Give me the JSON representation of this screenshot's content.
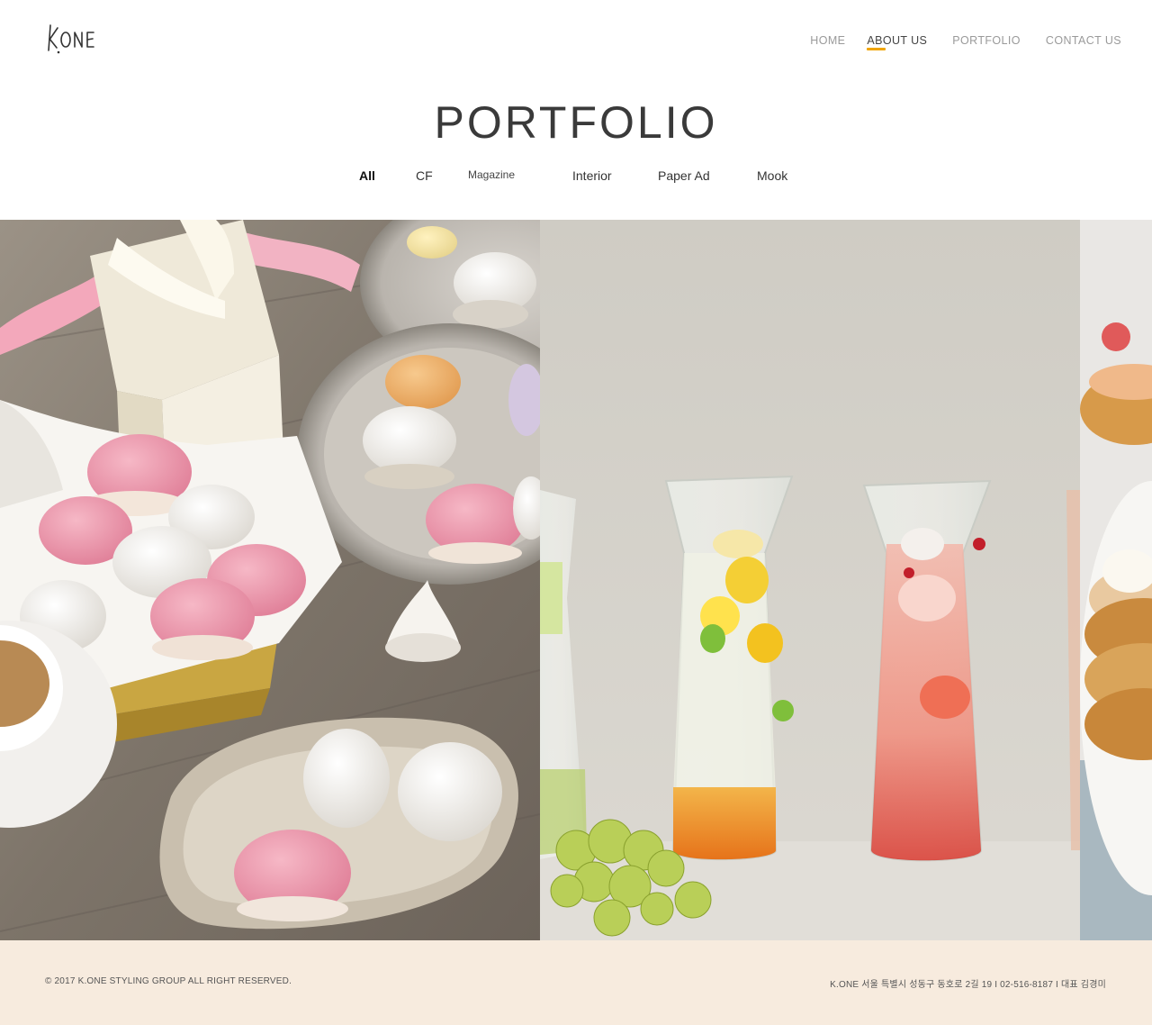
{
  "brand": {
    "logo_text": "K.ONE"
  },
  "nav": {
    "items": [
      {
        "label": "HOME"
      },
      {
        "label": "ABOUT US"
      },
      {
        "label": "PORTFOLIO"
      },
      {
        "label": "CONTACT US"
      }
    ],
    "active_index": 1,
    "accent_color": "#f0a500"
  },
  "page": {
    "title": "PORTFOLIO"
  },
  "filters": {
    "items": [
      {
        "label": "All"
      },
      {
        "label": "CF"
      },
      {
        "label": "Magazine"
      },
      {
        "label": "Interior"
      },
      {
        "label": "Paper Ad"
      },
      {
        "label": "Mook"
      }
    ],
    "active": "All"
  },
  "gallery": {
    "tiles": [
      {
        "subject": "macarons"
      },
      {
        "subject": "sparkling drinks in carafes"
      },
      {
        "subject": "pancakes"
      }
    ]
  },
  "footer": {
    "copyright": "© 2017 K.ONE STYLING GROUP ALL RIGHT RESERVED.",
    "info": "K.ONE 서울 특별시 성동구 동호로 2길 19 I 02-516-8187 I 대표 김경미",
    "background": "#f7ebde"
  }
}
